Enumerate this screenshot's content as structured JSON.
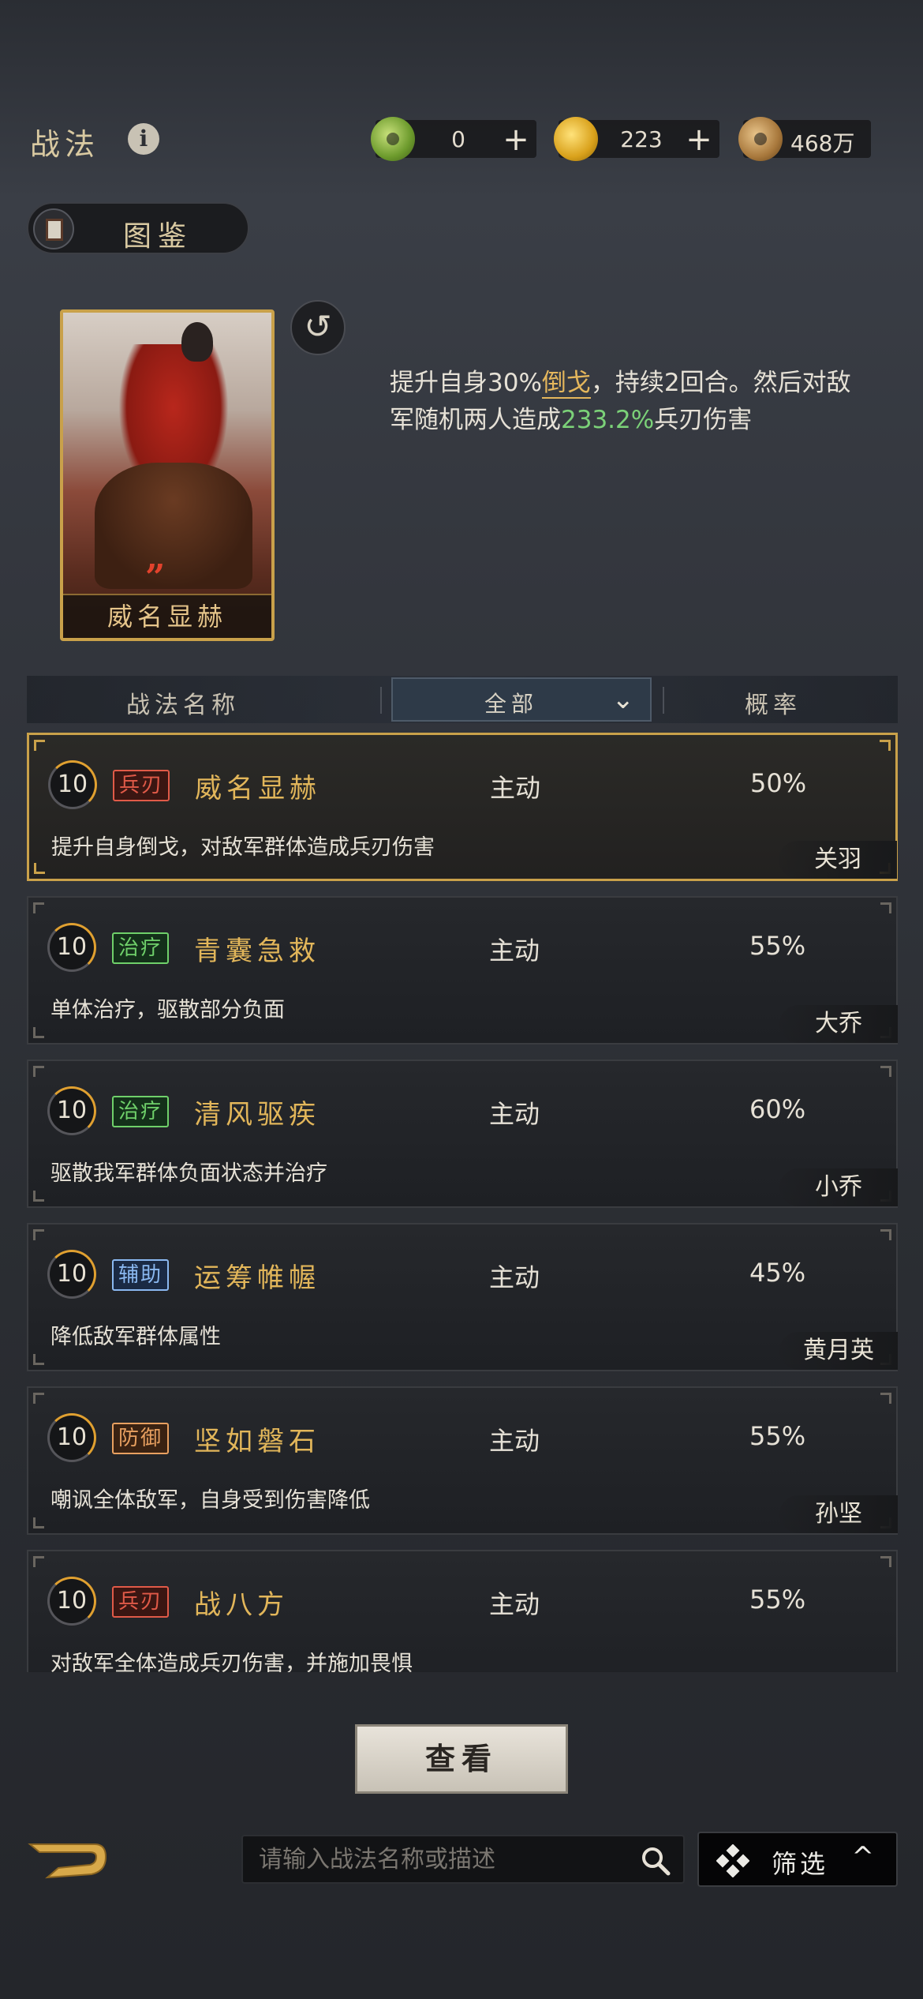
{
  "header": {
    "title": "战法",
    "info_icon": "i",
    "resources": [
      {
        "name": "jade",
        "value": "0",
        "plus": "+"
      },
      {
        "name": "gold",
        "value": "223",
        "plus": "+"
      },
      {
        "name": "copper",
        "value": "468万"
      }
    ]
  },
  "codex": {
    "label": "图鉴"
  },
  "featured": {
    "card_name": "威名显赫",
    "rank_mark": "”",
    "refresh_icon": "↺",
    "desc_parts": [
      "提升自身30%",
      "倒戈",
      "，持续2回合。然后对敌军随机两人造成",
      "233.2%",
      "兵刃伤害"
    ]
  },
  "list_header": {
    "name_col": "战法名称",
    "filter_value": "全部",
    "chevron": "⌄",
    "prob_col": "概率"
  },
  "skills": [
    {
      "level": "10",
      "tag": "兵刃",
      "tag_color": "red",
      "name": "威名显赫",
      "type": "主动",
      "prob": "50%",
      "desc": "提升自身倒戈，对敌军群体造成兵刃伤害",
      "general": "关羽",
      "selected": true
    },
    {
      "level": "10",
      "tag": "治疗",
      "tag_color": "green",
      "name": "青囊急救",
      "type": "主动",
      "prob": "55%",
      "desc": "单体治疗，驱散部分负面",
      "general": "大乔"
    },
    {
      "level": "10",
      "tag": "治疗",
      "tag_color": "green",
      "name": "清风驱疾",
      "type": "主动",
      "prob": "60%",
      "desc": "驱散我军群体负面状态并治疗",
      "general": "小乔"
    },
    {
      "level": "10",
      "tag": "辅助",
      "tag_color": "blue",
      "name": "运筹帷幄",
      "type": "主动",
      "prob": "45%",
      "desc": "降低敌军群体属性",
      "general": "黄月英"
    },
    {
      "level": "10",
      "tag": "防御",
      "tag_color": "orange",
      "name": "坚如磐石",
      "type": "主动",
      "prob": "55%",
      "desc": "嘲讽全体敌军，自身受到伤害降低",
      "general": "孙坚"
    },
    {
      "level": "10",
      "tag": "兵刃",
      "tag_color": "red",
      "name": "战八方",
      "type": "主动",
      "prob": "55%",
      "desc": "对敌军全体造成兵刃伤害，并施加畏惧",
      "general": ""
    }
  ],
  "footer": {
    "view_label": "查看",
    "search_placeholder": "请输入战法名称或描述",
    "filter_label": "筛选",
    "filter_chevron": "^"
  },
  "colors": {
    "accent_gold": "#c9a14a",
    "highlight_green": "#7bd178",
    "highlight_gold": "#e4b65c"
  }
}
